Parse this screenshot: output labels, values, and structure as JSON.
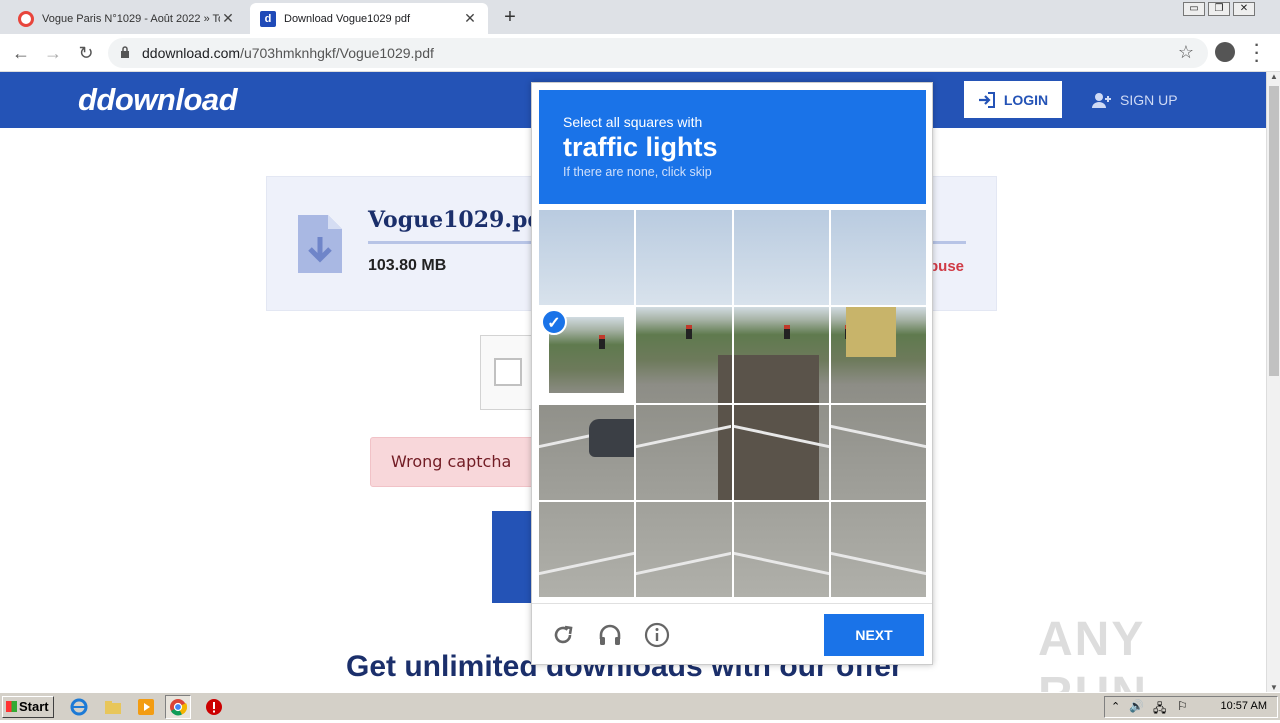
{
  "browser": {
    "tabs": [
      {
        "title": "Vogue Paris N°1029 - Août 2022 » To",
        "active": false
      },
      {
        "title": "Download Vogue1029 pdf",
        "active": true
      }
    ],
    "new_tab": "+",
    "url_domain": "ddownload.com",
    "url_path": "/u703hmknhgkf/Vogue1029.pdf",
    "window_controls": [
      "▭",
      "❐",
      "✕"
    ]
  },
  "site": {
    "logo": "ddownload",
    "login_label": "LOGIN",
    "signup_label": "SIGN UP",
    "file_name": "Vogue1029.pdf",
    "file_size": "103.80 MB",
    "abuse_text": "buse",
    "error_message": "Wrong captcha",
    "offer_text": "Get unlimited downloads with our offer",
    "brand_color": "#2453b6"
  },
  "captcha": {
    "instruction": "Select all squares with",
    "target": "traffic lights",
    "hint": "If there are none, click skip",
    "next_label": "NEXT",
    "selected_tiles": [
      4
    ],
    "accent_color": "#1a73e8"
  },
  "watermark": "ANY RUN",
  "taskbar": {
    "start_label": "Start",
    "time": "10:57 AM"
  }
}
